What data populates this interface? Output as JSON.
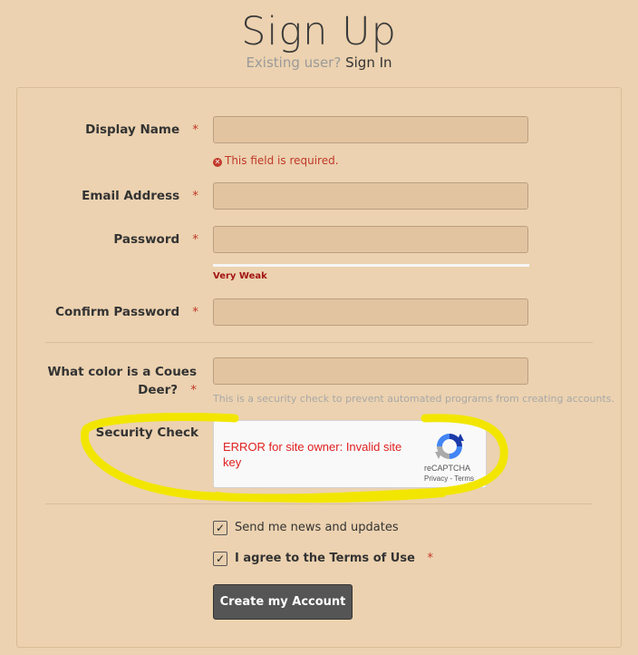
{
  "page": {
    "title": "Sign Up",
    "existing_user_prefix": "Existing user?",
    "sign_in_link": "Sign In"
  },
  "form": {
    "required_marker": "*",
    "display_name": {
      "label": "Display Name",
      "value": "",
      "error": "This field is required."
    },
    "email": {
      "label": "Email Address",
      "value": ""
    },
    "password": {
      "label": "Password",
      "value": "",
      "strength": "Very Weak"
    },
    "confirm_password": {
      "label": "Confirm Password",
      "value": ""
    },
    "security_question": {
      "label": "What color is a Coues Deer?",
      "value": "",
      "help": "This is a security check to prevent automated programs from creating accounts."
    },
    "security_check": {
      "label": "Security Check",
      "recaptcha_error": "ERROR for site owner: Invalid site key",
      "recaptcha_brand": "reCAPTCHA",
      "recaptcha_privacy": "Privacy",
      "recaptcha_separator": "-",
      "recaptcha_terms": "Terms"
    },
    "newsletter": {
      "label": "Send me news and updates",
      "checked": true
    },
    "terms": {
      "prefix": "I agree to the",
      "link": "Terms of Use",
      "checked": true
    },
    "submit_label": "Create my Account"
  },
  "colors": {
    "background": "#ecd2b0",
    "input_bg": "#e3c4a0",
    "error": "#c0392b",
    "highlight": "#f2e600",
    "button": "#555555"
  }
}
